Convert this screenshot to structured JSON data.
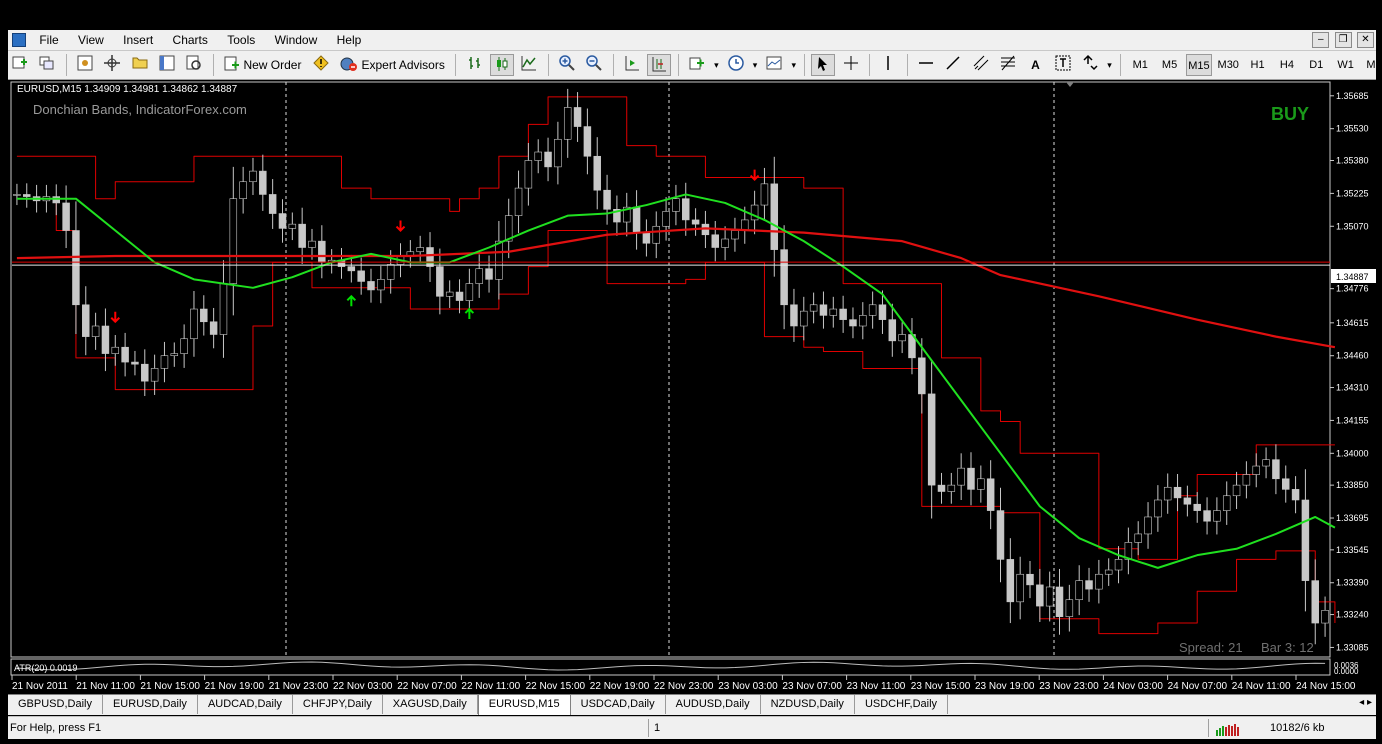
{
  "menu": [
    "File",
    "View",
    "Insert",
    "Charts",
    "Tools",
    "Window",
    "Help"
  ],
  "window_controls": [
    "–",
    "❐",
    "✕"
  ],
  "toolbar": {
    "new_order": "New Order",
    "expert_advisors": "Expert Advisors",
    "text_tool": "A",
    "timeframes": [
      "M1",
      "M5",
      "M15",
      "M30",
      "H1",
      "H4",
      "D1",
      "W1",
      "MN"
    ],
    "active_timeframe": "M15"
  },
  "chart": {
    "header": "EURUSD,M15  1.34909 1.34981 1.34862 1.34887",
    "watermark": "Donchian Bands, IndicatorForex.com",
    "signal": "BUY",
    "current_price": "1.34887",
    "spread": "Spread: 21",
    "bar_timer": "Bar  3: 12",
    "atr_label": "ATR(20) 0.0019",
    "atr_value": "0.0036",
    "atr_zero": "0.0000",
    "colors": {
      "band": "#e00000",
      "ma_fast": "#20e020",
      "ma_slow": "#e01010",
      "candle": "#c8c8c8",
      "buy": "#1a9a1a",
      "buy_arrow": "#00e000",
      "sell_arrow": "#ff0000"
    }
  },
  "chart_data": {
    "type": "candlestick",
    "symbol": "EURUSD",
    "timeframe": "M15",
    "y_ticks": [
      "1.35685",
      "1.35530",
      "1.35380",
      "1.35225",
      "1.35070",
      "1.34776",
      "1.34615",
      "1.34460",
      "1.34310",
      "1.34155",
      "1.34000",
      "1.33850",
      "1.33695",
      "1.33545",
      "1.33390",
      "1.33240",
      "1.33085"
    ],
    "x_ticks": [
      "21 Nov 2011",
      "21 Nov 11:00",
      "21 Nov 15:00",
      "21 Nov 19:00",
      "21 Nov 23:00",
      "22 Nov 03:00",
      "22 Nov 07:00",
      "22 Nov 11:00",
      "22 Nov 15:00",
      "22 Nov 19:00",
      "22 Nov 23:00",
      "23 Nov 03:00",
      "23 Nov 07:00",
      "23 Nov 11:00",
      "23 Nov 15:00",
      "23 Nov 19:00",
      "23 Nov 23:00",
      "24 Nov 03:00",
      "24 Nov 07:00",
      "24 Nov 11:00",
      "24 Nov 15:00"
    ],
    "ylim": [
      1.3304,
      1.3575
    ],
    "series": [
      {
        "kind": "close",
        "values": [
          1.3522,
          1.3521,
          1.3519,
          1.3521,
          1.3518,
          1.3505,
          1.347,
          1.3455,
          1.346,
          1.3447,
          1.345,
          1.3443,
          1.3442,
          1.3434,
          1.344,
          1.3446,
          1.3447,
          1.3454,
          1.3468,
          1.3462,
          1.3456,
          1.348,
          1.352,
          1.3528,
          1.3533,
          1.3522,
          1.3513,
          1.3506,
          1.3508,
          1.3497,
          1.35,
          1.349,
          1.3491,
          1.3488,
          1.3486,
          1.3481,
          1.3477,
          1.3482,
          1.3489,
          1.3493,
          1.3495,
          1.3497,
          1.3488,
          1.3474,
          1.3476,
          1.3472,
          1.348,
          1.3487,
          1.3482,
          1.35,
          1.3512,
          1.3525,
          1.3538,
          1.3542,
          1.3535,
          1.3548,
          1.3563,
          1.3554,
          1.354,
          1.3524,
          1.3515,
          1.3509,
          1.3516,
          1.3504,
          1.3499,
          1.3507,
          1.3514,
          1.352,
          1.351,
          1.3508,
          1.3503,
          1.3497,
          1.3501,
          1.3505,
          1.351,
          1.3517,
          1.3527,
          1.3496,
          1.347,
          1.346,
          1.3467,
          1.347,
          1.3465,
          1.3468,
          1.3463,
          1.346,
          1.3465,
          1.347,
          1.3463,
          1.3453,
          1.3456,
          1.3445,
          1.3428,
          1.3385,
          1.3382,
          1.3385,
          1.3393,
          1.3383,
          1.3388,
          1.3373,
          1.335,
          1.333,
          1.3343,
          1.3338,
          1.3328,
          1.3337,
          1.3323,
          1.3331,
          1.334,
          1.3336,
          1.3343,
          1.3345,
          1.335,
          1.3358,
          1.3362,
          1.337,
          1.3378,
          1.3384,
          1.3379,
          1.3376,
          1.3373,
          1.3368,
          1.3373,
          1.338,
          1.3385,
          1.339,
          1.3394,
          1.3397,
          1.3388,
          1.3383,
          1.3378,
          1.334,
          1.332,
          1.3326
        ]
      },
      {
        "kind": "donchian_upper",
        "points": [
          [
            0,
            1.354
          ],
          [
            4,
            1.354
          ],
          [
            8,
            1.352
          ],
          [
            10,
            1.3528
          ],
          [
            14,
            1.3528
          ],
          [
            18,
            1.354
          ],
          [
            30,
            1.354
          ],
          [
            33,
            1.3525
          ],
          [
            36,
            1.352
          ],
          [
            40,
            1.352
          ],
          [
            44,
            1.3514
          ],
          [
            45,
            1.352
          ],
          [
            47,
            1.3525
          ],
          [
            49,
            1.354
          ],
          [
            52,
            1.3555
          ],
          [
            54,
            1.3568
          ],
          [
            60,
            1.3568
          ],
          [
            62,
            1.3545
          ],
          [
            65,
            1.354
          ],
          [
            70,
            1.353
          ],
          [
            76,
            1.353
          ],
          [
            80,
            1.3525
          ],
          [
            84,
            1.348
          ],
          [
            90,
            1.348
          ],
          [
            94,
            1.3445
          ],
          [
            98,
            1.342
          ],
          [
            100,
            1.3415
          ],
          [
            102,
            1.34
          ],
          [
            110,
            1.3355
          ],
          [
            114,
            1.335
          ],
          [
            118,
            1.338
          ],
          [
            120,
            1.339
          ],
          [
            124,
            1.339
          ],
          [
            126,
            1.3404
          ],
          [
            134,
            1.3404
          ]
        ]
      },
      {
        "kind": "donchian_lower",
        "points": [
          [
            0,
            1.352
          ],
          [
            4,
            1.3505
          ],
          [
            6,
            1.3445
          ],
          [
            10,
            1.343
          ],
          [
            18,
            1.343
          ],
          [
            24,
            1.346
          ],
          [
            26,
            1.349
          ],
          [
            30,
            1.3478
          ],
          [
            36,
            1.3478
          ],
          [
            40,
            1.3468
          ],
          [
            46,
            1.3468
          ],
          [
            49,
            1.3475
          ],
          [
            52,
            1.3488
          ],
          [
            54,
            1.3505
          ],
          [
            60,
            1.348
          ],
          [
            64,
            1.348
          ],
          [
            68,
            1.3482
          ],
          [
            70,
            1.349
          ],
          [
            74,
            1.349
          ],
          [
            76,
            1.3455
          ],
          [
            80,
            1.345
          ],
          [
            82,
            1.3448
          ],
          [
            86,
            1.344
          ],
          [
            92,
            1.3375
          ],
          [
            100,
            1.3372
          ],
          [
            104,
            1.3322
          ],
          [
            110,
            1.3315
          ],
          [
            116,
            1.332
          ],
          [
            120,
            1.3335
          ],
          [
            124,
            1.335
          ],
          [
            128,
            1.3354
          ],
          [
            132,
            1.333
          ],
          [
            134,
            1.332
          ]
        ]
      },
      {
        "kind": "ma_fast",
        "points": [
          [
            0,
            1.352
          ],
          [
            6,
            1.352
          ],
          [
            10,
            1.3505
          ],
          [
            14,
            1.349
          ],
          [
            18,
            1.3482
          ],
          [
            24,
            1.3478
          ],
          [
            28,
            1.3483
          ],
          [
            32,
            1.349
          ],
          [
            36,
            1.3494
          ],
          [
            40,
            1.349
          ],
          [
            44,
            1.349
          ],
          [
            48,
            1.3497
          ],
          [
            52,
            1.3505
          ],
          [
            56,
            1.3512
          ],
          [
            60,
            1.3513
          ],
          [
            64,
            1.3517
          ],
          [
            68,
            1.3522
          ],
          [
            72,
            1.3518
          ],
          [
            76,
            1.351
          ],
          [
            80,
            1.35
          ],
          [
            84,
            1.3488
          ],
          [
            88,
            1.3475
          ],
          [
            92,
            1.345
          ],
          [
            96,
            1.3425
          ],
          [
            100,
            1.34
          ],
          [
            104,
            1.3375
          ],
          [
            108,
            1.336
          ],
          [
            112,
            1.3352
          ],
          [
            116,
            1.3346
          ],
          [
            120,
            1.3352
          ],
          [
            124,
            1.3355
          ],
          [
            128,
            1.3362
          ],
          [
            132,
            1.337
          ],
          [
            134,
            1.3365
          ]
        ]
      },
      {
        "kind": "ma_slow",
        "points": [
          [
            0,
            1.3492
          ],
          [
            10,
            1.3493
          ],
          [
            20,
            1.3493
          ],
          [
            30,
            1.3493
          ],
          [
            40,
            1.3493
          ],
          [
            50,
            1.3495
          ],
          [
            60,
            1.3503
          ],
          [
            70,
            1.3506
          ],
          [
            80,
            1.3504
          ],
          [
            90,
            1.35
          ],
          [
            96,
            1.3492
          ],
          [
            100,
            1.3484
          ],
          [
            110,
            1.3474
          ],
          [
            120,
            1.3463
          ],
          [
            128,
            1.3455
          ],
          [
            134,
            1.345
          ]
        ]
      }
    ],
    "signals": [
      {
        "i": 10,
        "type": "sell"
      },
      {
        "i": 34,
        "type": "buy"
      },
      {
        "i": 39,
        "type": "sell"
      },
      {
        "i": 46,
        "type": "buy"
      },
      {
        "i": 75,
        "type": "sell"
      }
    ]
  },
  "tabs": [
    "GBPUSD,Daily",
    "EURUSD,Daily",
    "AUDCAD,Daily",
    "CHFJPY,Daily",
    "XAGUSD,Daily",
    "EURUSD,M15",
    "USDCAD,Daily",
    "AUDUSD,Daily",
    "NZDUSD,Daily",
    "USDCHF,Daily"
  ],
  "active_tab": "EURUSD,M15",
  "status": {
    "help": "For Help, press F1",
    "profile": "1",
    "traffic": "10182/6 kb"
  }
}
